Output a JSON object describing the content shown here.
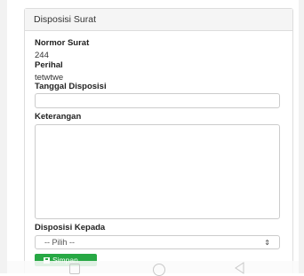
{
  "panel": {
    "title": "Disposisi Surat"
  },
  "form": {
    "nomor_label": "Normor Surat",
    "nomor_value": "244",
    "perihal_label": "Perihal",
    "perihal_value": "tetwtwe",
    "tanggal_label": "Tanggal Disposisi",
    "tanggal_value": "",
    "keterangan_label": "Keterangan",
    "keterangan_value": "",
    "kepada_label": "Disposisi Kepada",
    "kepada_selected": "-- Pilih --",
    "save_label": "Simpan"
  },
  "icons": {
    "save": "floppy-disk-icon",
    "select_arrow": "up-down-arrow-icon",
    "nav_recent": "square-icon",
    "nav_home": "circle-icon",
    "nav_back": "triangle-back-icon"
  },
  "colors": {
    "save_button": "#27a844",
    "panel_heading_bg": "#f5f5f5",
    "border": "#dddddd"
  }
}
